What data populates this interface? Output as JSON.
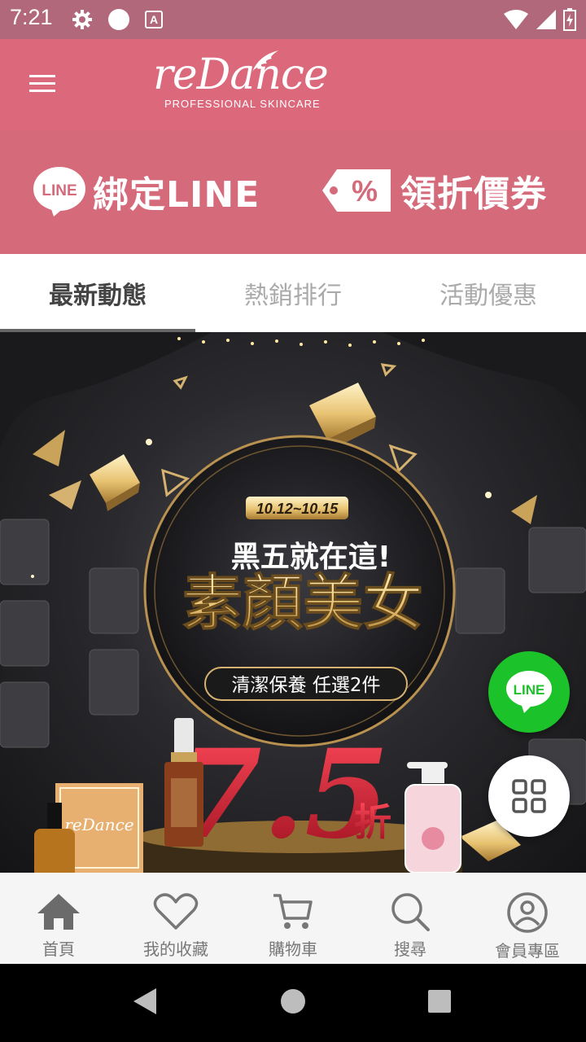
{
  "status_bar": {
    "time": "7:21",
    "icons": [
      "settings-icon",
      "circle-icon",
      "a-icon",
      "wifi-icon",
      "signal-icon",
      "battery-icon"
    ]
  },
  "header": {
    "logo_text": "reDance",
    "logo_sub": "PROFESSIONAL SKINCARE",
    "menu_icon": "hamburger-icon"
  },
  "promo": {
    "line_badge": "LINE",
    "line_label": "綁定LINE",
    "coupon_badge": "%",
    "coupon_label": "領折價券"
  },
  "tabs": [
    {
      "label": "最新動態",
      "active": true
    },
    {
      "label": "熱銷排行",
      "active": false
    },
    {
      "label": "活動優惠",
      "active": false
    }
  ],
  "banner": {
    "date": "10.12~10.15",
    "headline": "黑五就在這!",
    "title": "素顏美女",
    "subtitle": "清潔保養 任選2件",
    "discount": "7.5",
    "discount_unit": "折",
    "product_brand": "reDance"
  },
  "fab": {
    "line_label": "LINE",
    "grid_icon": "grid-icon"
  },
  "bottom_nav": [
    {
      "label": "首頁",
      "icon": "home-icon"
    },
    {
      "label": "我的收藏",
      "icon": "heart-icon"
    },
    {
      "label": "購物車",
      "icon": "cart-icon"
    },
    {
      "label": "搜尋",
      "icon": "search-icon"
    },
    {
      "label": "會員專區",
      "icon": "user-icon"
    }
  ],
  "colors": {
    "status_bar": "#b0687a",
    "header": "#dc687c",
    "promo_bar": "#d56a7b",
    "line_green": "#1cc22a",
    "gold": "#d9b46a",
    "discount_red": "#c0182a"
  }
}
